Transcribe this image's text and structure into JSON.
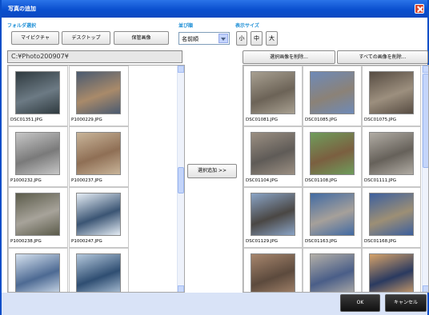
{
  "window": {
    "title": "写真の追加"
  },
  "folder_select": {
    "label": "フォルダ選択",
    "buttons": [
      "マイピクチャ",
      "デスクトップ",
      "保管画像"
    ]
  },
  "sort": {
    "label": "並び順",
    "selected": "名前順"
  },
  "display_size": {
    "label": "表示サイズ",
    "buttons": [
      "小",
      "中",
      "大"
    ]
  },
  "path": "C:¥Photo200907¥",
  "actions": {
    "delete_selected": "選択画像を削除...",
    "delete_all": "すべての画像を削除...",
    "add_selected": "選択追加 >>"
  },
  "left_files": [
    "DSC01351.JPG",
    "P1000229.JPG",
    "P1000232.JPG",
    "P1000237.JPG",
    "P1000238.JPG",
    "P1000247.JPG",
    "",
    ""
  ],
  "right_files": [
    "DSC01081.JPG",
    "DSC01085.JPG",
    "DSC01075.JPG",
    "DSC01104.JPG",
    "DSC01108.JPG",
    "DSC01111.JPG",
    "DSC01129.JPG",
    "DSC01163.JPG",
    "DSC01168.JPG",
    "",
    "",
    ""
  ],
  "footer": {
    "ok": "OK",
    "cancel": "キャンセル"
  },
  "colors": {
    "title_bar": "#0a4fcf",
    "section_label": "#1e8fd6",
    "bottom_bar": "#d9e3f7"
  }
}
